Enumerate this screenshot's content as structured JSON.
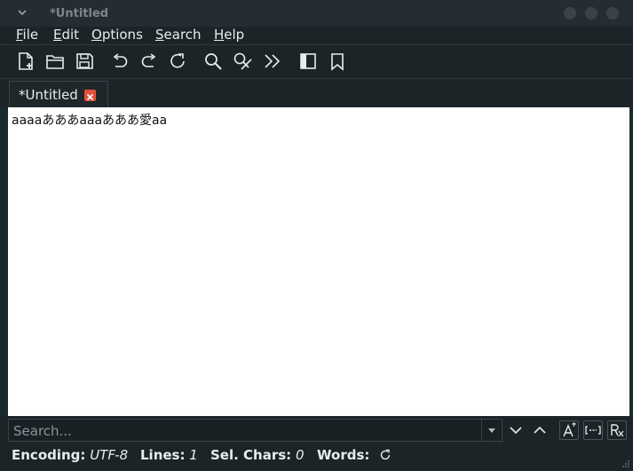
{
  "window": {
    "title": "*Untitled"
  },
  "menu": {
    "file": {
      "u": "F",
      "rest": "ile"
    },
    "edit": {
      "u": "E",
      "rest": "dit"
    },
    "options": {
      "u": "O",
      "rest": "ptions"
    },
    "search": {
      "u": "S",
      "rest": "earch"
    },
    "help": {
      "u": "H",
      "rest": "elp"
    }
  },
  "toolbar": {
    "icons": [
      "new-document-icon",
      "open-folder-icon",
      "save-icon",
      "undo-icon",
      "redo-icon",
      "reload-icon",
      "find-icon",
      "find-replace-icon",
      "go-to-icon",
      "side-pane-icon",
      "bookmark-icon"
    ]
  },
  "tabs": [
    {
      "label": "*Untitled"
    }
  ],
  "editor": {
    "content": "aaaaあああaaaあああ愛aa"
  },
  "search": {
    "placeholder": "Search...",
    "value": ""
  },
  "status": {
    "encoding_label": "Encoding:",
    "encoding_value": "UTF-8",
    "lines_label": "Lines:",
    "lines_value": "1",
    "sel_label": "Sel. Chars:",
    "sel_value": "0",
    "words_label": "Words:"
  },
  "colors": {
    "chrome": "#1d2427",
    "editor_bg": "#ffffff",
    "tab_close": "#e3513b"
  }
}
